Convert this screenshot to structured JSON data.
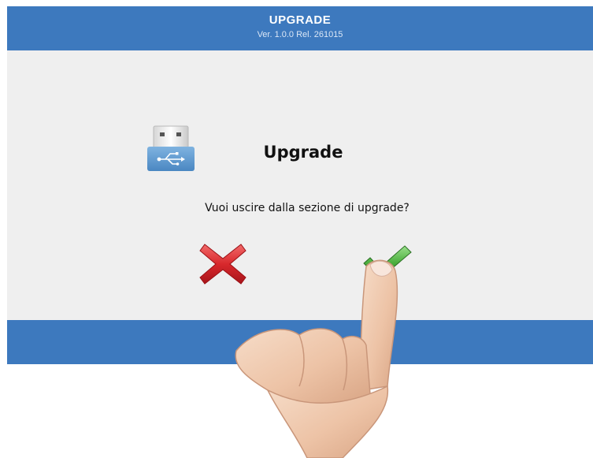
{
  "header": {
    "title": "UPGRADE",
    "version": "Ver. 1.0.0 Rel. 261015"
  },
  "dialog": {
    "title": "Upgrade",
    "message": "Vuoi uscire dalla sezione di upgrade?",
    "icon": "usb-drive-icon"
  },
  "actions": {
    "cancel_icon": "red-x-icon",
    "confirm_icon": "green-check-icon"
  },
  "colors": {
    "bar": "#3d79be",
    "panel": "#efefef",
    "cancel": "#d8282c",
    "confirm": "#4caf3f",
    "usb_body": "#5b9bd1"
  }
}
